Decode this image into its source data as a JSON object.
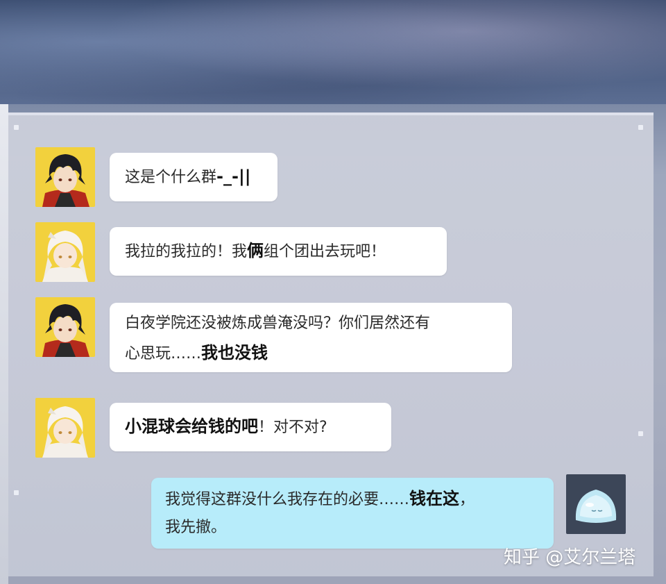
{
  "chat": {
    "messages": [
      {
        "sender": "black-hair-boy",
        "side": "left",
        "parts": [
          {
            "text": "这是个什么群",
            "strong": false
          },
          {
            "text": "-_-||",
            "strong": true
          }
        ]
      },
      {
        "sender": "white-hair-girl",
        "side": "left",
        "parts": [
          {
            "text": "我拉的我拉的！我",
            "strong": false
          },
          {
            "text": "俩",
            "strong": true
          },
          {
            "text": "组个团出去玩吧！",
            "strong": false
          }
        ]
      },
      {
        "sender": "black-hair-boy",
        "side": "left",
        "line1": "白夜学院还没被炼成兽淹没吗？你们居然还有",
        "line2_plain": "心思玩……",
        "line2_strong": "我也没钱"
      },
      {
        "sender": "white-hair-girl",
        "side": "left",
        "parts": [
          {
            "text": "小混球会给钱的吧",
            "strong": true
          },
          {
            "text": "！对不对?",
            "strong": false
          }
        ]
      },
      {
        "sender": "slime",
        "side": "right",
        "line1_plain": "我觉得这群没什么我存在的必要……",
        "line1_strong": "钱在这",
        "line1_tail": "，",
        "line2": "我先撤。"
      }
    ]
  },
  "watermark": "知乎 @艾尔兰塔",
  "colors": {
    "bubble_other": "#ffffff",
    "bubble_self": "#b7ecfa",
    "avatar_bg": "#f2d13d"
  },
  "icons": {
    "avatar_1": "black-hair-boy-avatar-icon",
    "avatar_2": "white-hair-girl-avatar-icon",
    "avatar_self": "blue-slime-avatar-icon"
  }
}
